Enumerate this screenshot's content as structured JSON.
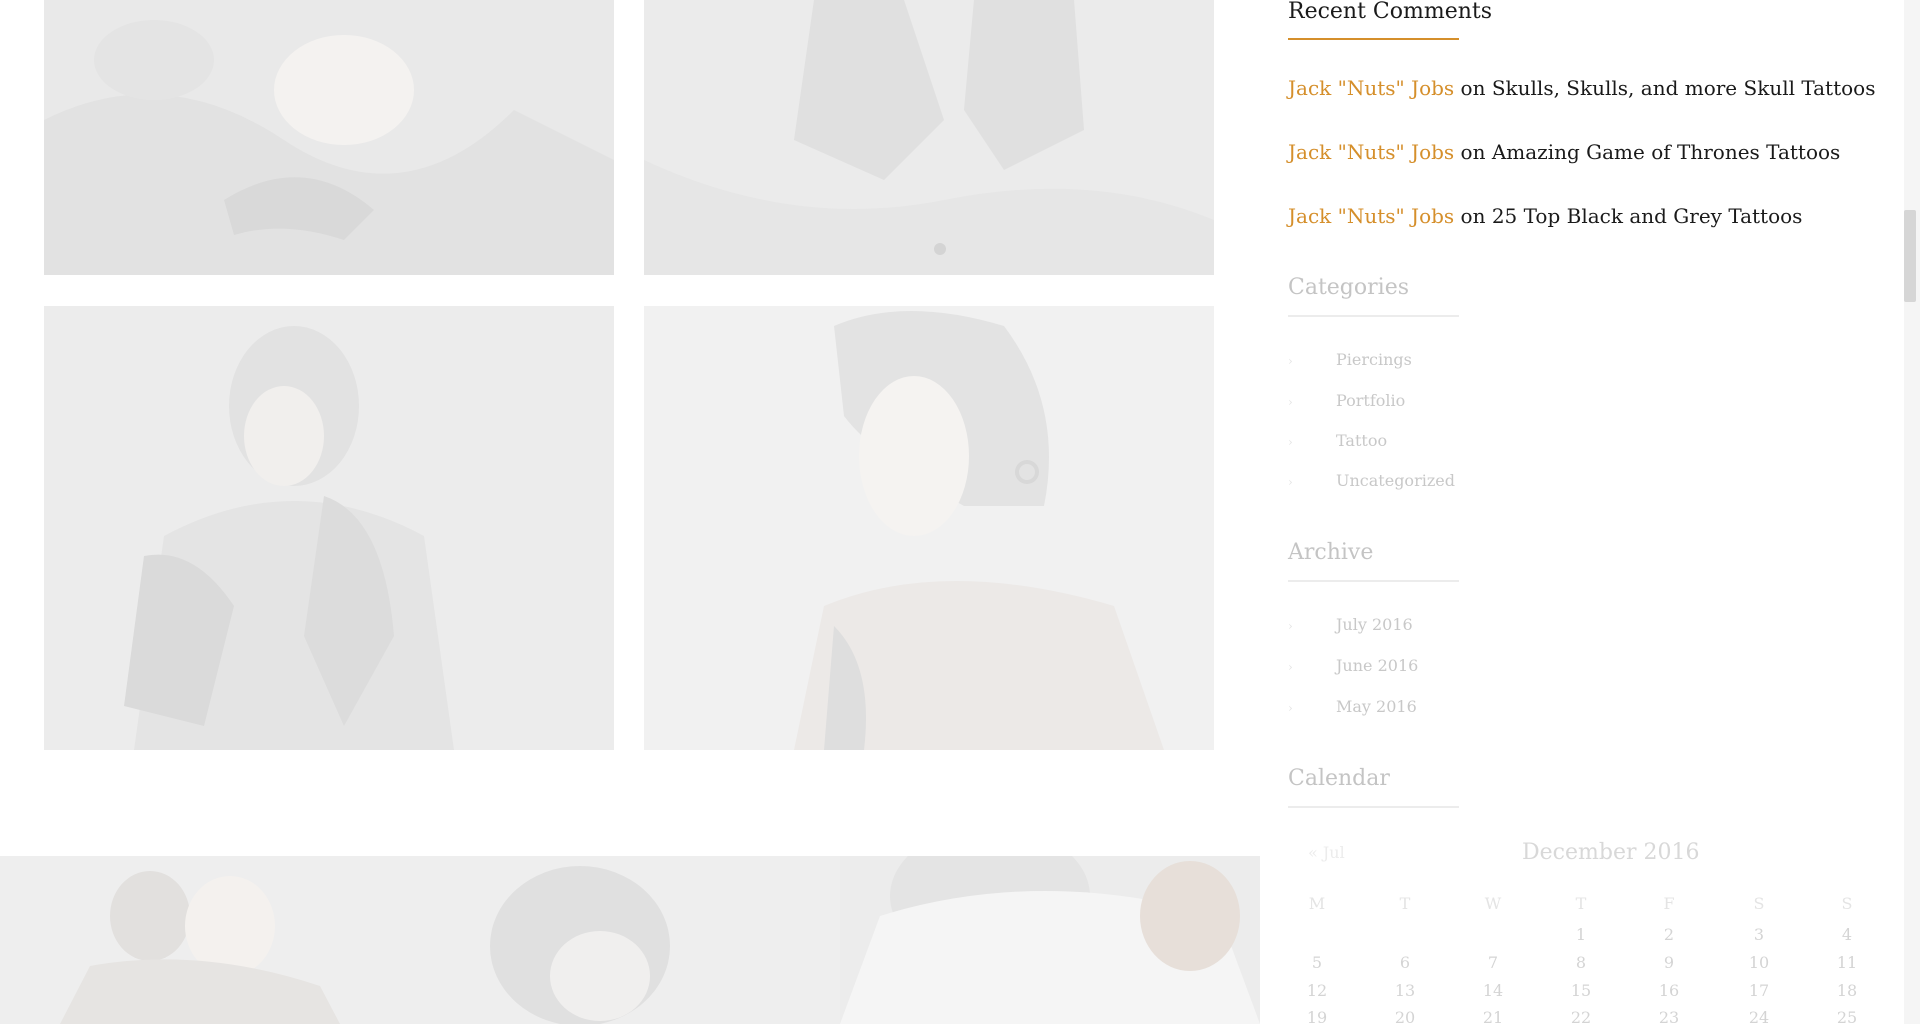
{
  "recent_comments": {
    "title": "Recent Comments",
    "items": [
      {
        "author": "Jack \"Nuts\" Jobs",
        "on": "on",
        "post": "Skulls, Skulls, and more Skull Tattoos"
      },
      {
        "author": "Jack \"Nuts\" Jobs",
        "on": "on",
        "post": "Amazing Game of Thrones Tattoos"
      },
      {
        "author": "Jack \"Nuts\" Jobs",
        "on": "on",
        "post": "25 Top Black and Grey Tattoos"
      }
    ]
  },
  "categories": {
    "title": "Categories",
    "items": [
      "Piercings",
      "Portfolio",
      "Tattoo",
      "Uncategorized"
    ]
  },
  "archive": {
    "title": "Archive",
    "items": [
      "July 2016",
      "June 2016",
      "May 2016"
    ]
  },
  "calendar": {
    "title": "Calendar",
    "caption": "December 2016",
    "prev_link": "« Jul",
    "weekdays": [
      "M",
      "T",
      "W",
      "T",
      "F",
      "S",
      "S"
    ],
    "weeks": [
      [
        "",
        "",
        "",
        "1",
        "2",
        "3",
        "4"
      ],
      [
        "5",
        "6",
        "7",
        "8",
        "9",
        "10",
        "11"
      ],
      [
        "12",
        "13",
        "14",
        "15",
        "16",
        "17",
        "18"
      ],
      [
        "19",
        "20",
        "21",
        "22",
        "23",
        "24",
        "25"
      ]
    ]
  },
  "colors": {
    "accent": "#d58f2b",
    "text": "#1a1a1a",
    "faded_text": "#c8c8c8"
  },
  "icons": {
    "list_bullet": "chevron-right-icon"
  }
}
